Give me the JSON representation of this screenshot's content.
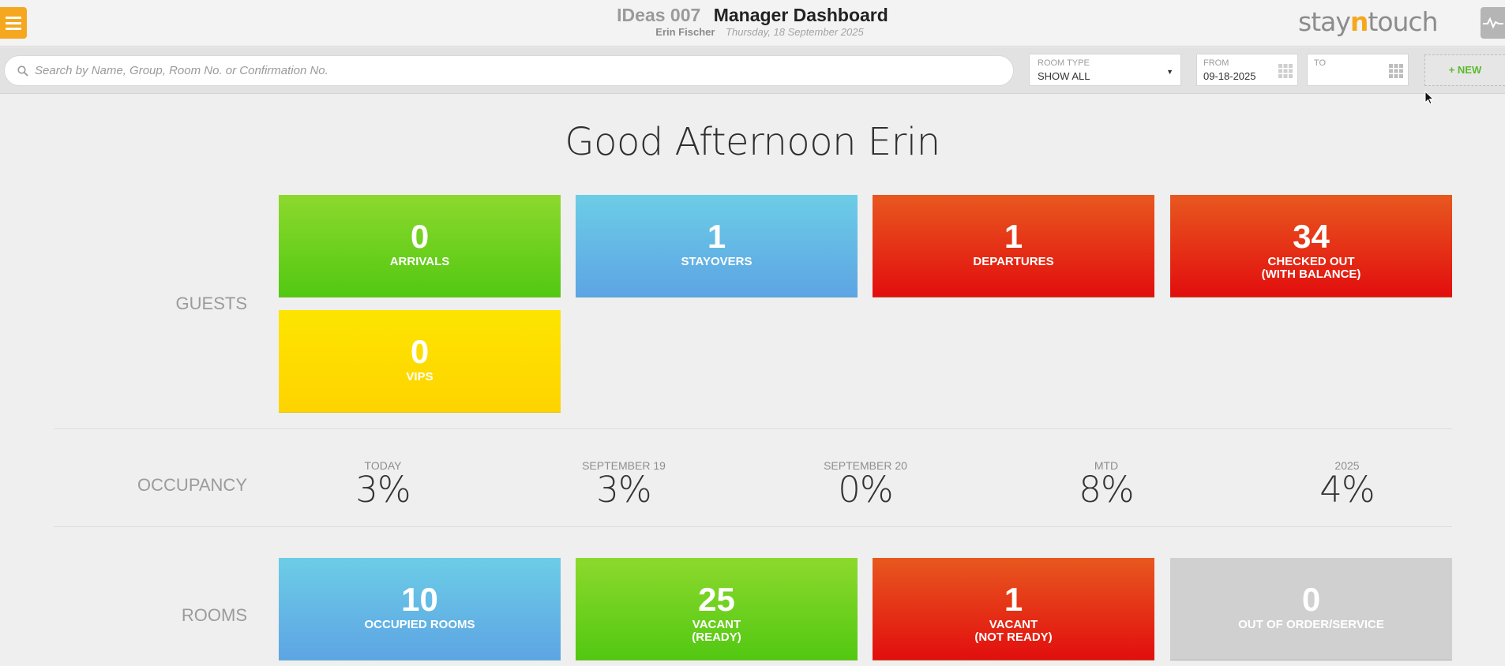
{
  "header": {
    "hotel_name": "IDeas 007",
    "dashboard_title": "Manager Dashboard",
    "user_name": "Erin Fischer",
    "date": "Thursday, 18 September 2025",
    "logo": {
      "part1": "stay",
      "part2": "n",
      "part3": "touch"
    },
    "accent_color": "#f5a81f"
  },
  "search": {
    "placeholder": "Search by Name, Group, Room No. or Confirmation No.",
    "value": ""
  },
  "filters": {
    "room_type_label": "ROOM TYPE",
    "room_type_value": "SHOW ALL",
    "from_label": "FROM",
    "from_value": "09-18-2025",
    "to_label": "TO",
    "to_value": "",
    "new_button": "+ NEW"
  },
  "greeting": "Good Afternoon Erin",
  "guests": {
    "section_label": "GUESTS",
    "tiles": [
      {
        "value": "0",
        "label": "ARRIVALS",
        "label2": "",
        "color": "green"
      },
      {
        "value": "1",
        "label": "STAYOVERS",
        "label2": "",
        "color": "blue"
      },
      {
        "value": "1",
        "label": "DEPARTURES",
        "label2": "",
        "color": "red"
      },
      {
        "value": "34",
        "label": "CHECKED OUT",
        "label2": "(WITH BALANCE)",
        "color": "red"
      },
      {
        "value": "0",
        "label": "VIPS",
        "label2": "",
        "color": "yellow"
      }
    ]
  },
  "occupancy": {
    "section_label": "OCCUPANCY",
    "items": [
      {
        "label": "TODAY",
        "value": "3%"
      },
      {
        "label": "SEPTEMBER 19",
        "value": "3%"
      },
      {
        "label": "SEPTEMBER 20",
        "value": "0%"
      },
      {
        "label": "MTD",
        "value": "8%"
      },
      {
        "label": "2025",
        "value": "4%"
      }
    ]
  },
  "rooms": {
    "section_label": "ROOMS",
    "tiles": [
      {
        "value": "10",
        "label": "OCCUPIED ROOMS",
        "label2": "",
        "color": "blue"
      },
      {
        "value": "25",
        "label": "VACANT",
        "label2": "(READY)",
        "color": "green"
      },
      {
        "value": "1",
        "label": "VACANT",
        "label2": "(NOT READY)",
        "color": "red"
      },
      {
        "value": "0",
        "label": "OUT OF ORDER/SERVICE",
        "label2": "",
        "color": "grey"
      }
    ]
  }
}
